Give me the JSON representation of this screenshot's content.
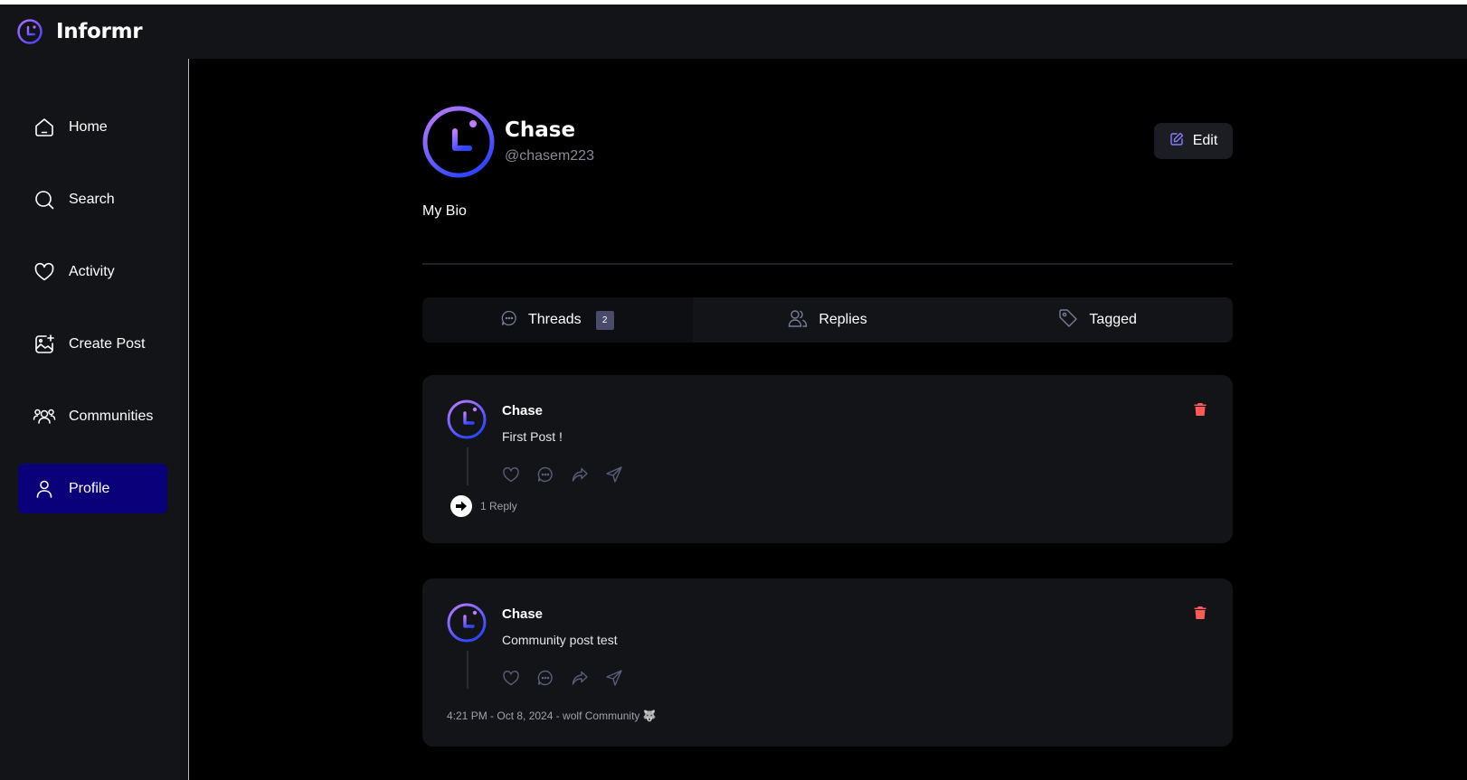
{
  "app": {
    "name": "Informr",
    "accent": "#877eff",
    "sidebar_active_bg": "#09007a"
  },
  "sidebar": {
    "items": [
      {
        "label": "Home",
        "icon": "home-icon"
      },
      {
        "label": "Search",
        "icon": "search-icon"
      },
      {
        "label": "Activity",
        "icon": "heart-icon"
      },
      {
        "label": "Create Post",
        "icon": "create-post-icon"
      },
      {
        "label": "Communities",
        "icon": "communities-icon"
      },
      {
        "label": "Profile",
        "icon": "user-icon",
        "active": true
      }
    ]
  },
  "profile": {
    "name": "Chase",
    "handle": "@chasem223",
    "bio": "My Bio",
    "edit_label": "Edit"
  },
  "tabs": [
    {
      "label": "Threads",
      "icon": "chat-bubble-icon",
      "count": "2",
      "active": true
    },
    {
      "label": "Replies",
      "icon": "members-icon"
    },
    {
      "label": "Tagged",
      "icon": "tag-icon"
    }
  ],
  "posts": [
    {
      "author": "Chase",
      "text": "First Post !",
      "replies": "1 Reply"
    },
    {
      "author": "Chase",
      "text": "Community post test",
      "meta": "4:21 PM - Oct 8, 2024 - wolf Community 🐺"
    }
  ]
}
